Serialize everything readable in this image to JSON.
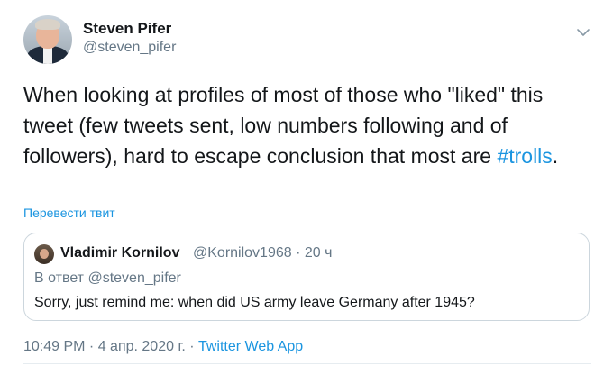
{
  "author": {
    "display_name": "Steven Pifer",
    "handle": "@steven_pifer"
  },
  "tweet": {
    "text_before_hashtag": "When looking at profiles of most of those who \"liked\" this tweet (few tweets sent, low numbers following and of followers), hard to escape conclusion that most are ",
    "hashtag": "#trolls",
    "text_after_hashtag": ".",
    "translate_label": "Перевести твит"
  },
  "quoted_tweet": {
    "display_name": "Vladimir Kornilov",
    "handle_and_time": "@Kornilov1968 · 20 ч",
    "reply_context": "В ответ @steven_pifer",
    "text": "Sorry, just remind me: when did US army leave Germany after 1945?"
  },
  "meta": {
    "timestamp": "10:49 PM · 4 апр. 2020 г. · ",
    "source_app": "Twitter Web App"
  },
  "colors": {
    "link": "#1b95e0",
    "secondary_text": "#657786",
    "border": "#ccd6dd"
  },
  "icons": {
    "menu": "chevron-down-icon"
  }
}
